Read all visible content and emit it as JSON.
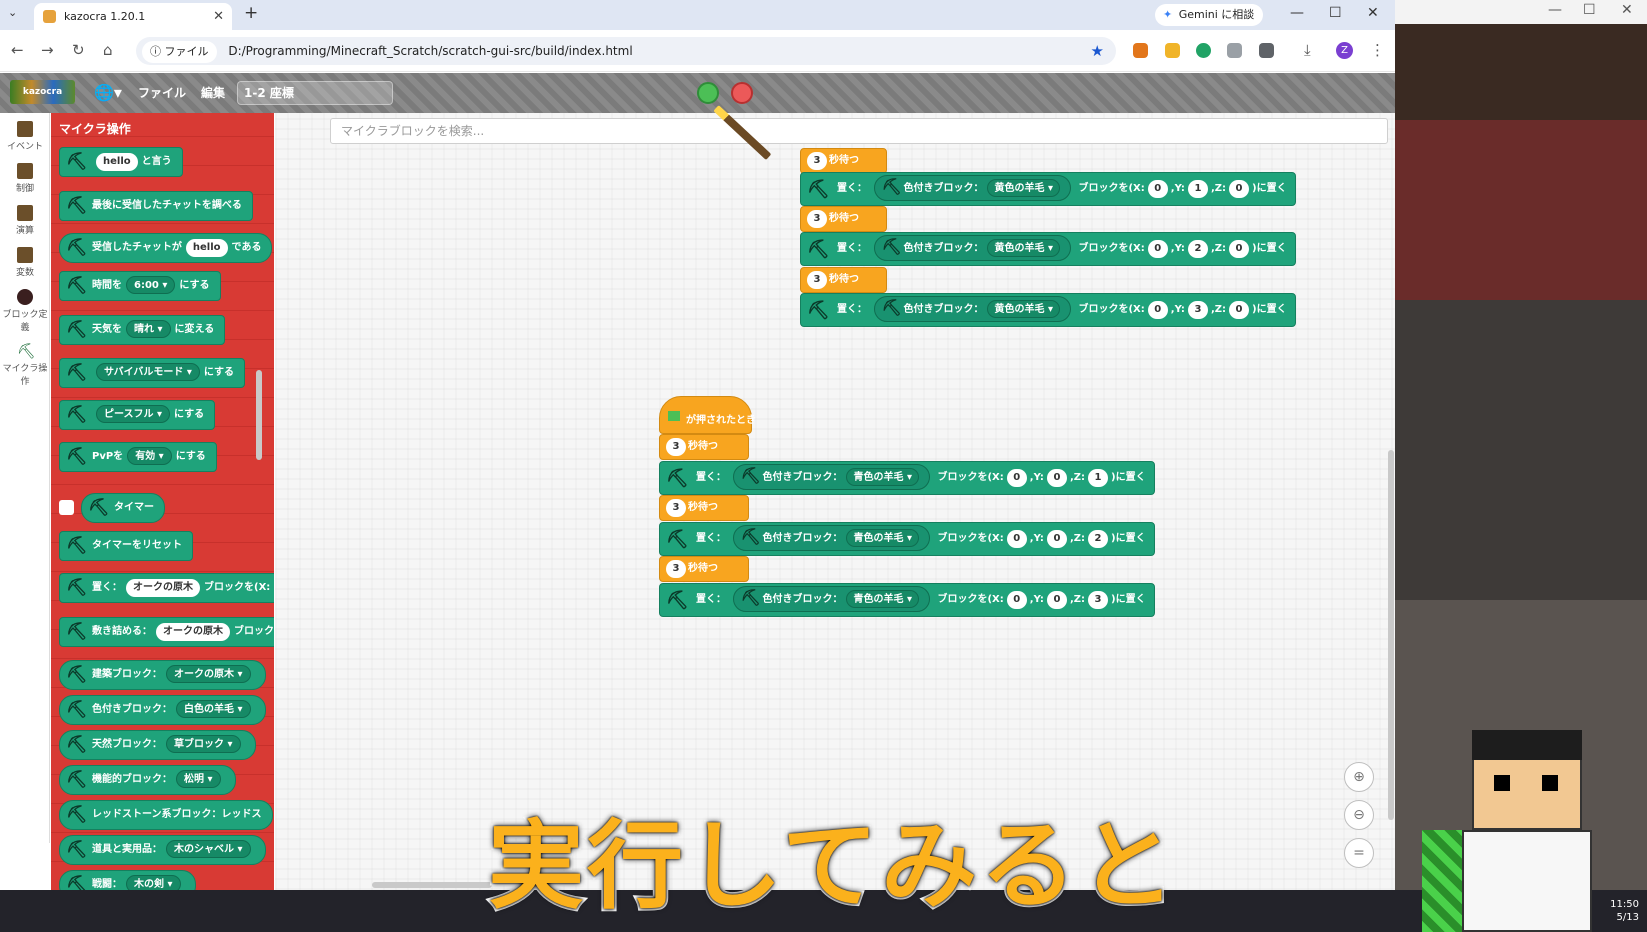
{
  "browser": {
    "tab_title": "kazocra 1.20.1",
    "gemini_label": "Gemini に相談",
    "security_label": "ファイル",
    "url": "D:/Programming/Minecraft_Scratch/scratch-gui-src/build/index.html",
    "profile_initial": "Z"
  },
  "menubar": {
    "file_label": "ファイル",
    "edit_label": "編集",
    "project_title": "1-2 座標"
  },
  "categories": [
    "イベント",
    "制御",
    "演算",
    "変数",
    "ブロック定義",
    "マイクラ操作"
  ],
  "flyout": {
    "title": "マイクラ操作",
    "blocks": {
      "say_value": "hello",
      "say_suffix": "と言う",
      "last_chat": "最後に受信したチャットを調べる",
      "chat_prefix": "受信したチャットが",
      "chat_value": "hello",
      "chat_suffix": "である",
      "time_prefix": "時間を",
      "time_value": "6:00",
      "time_suffix": "にする",
      "weather_prefix": "天気を",
      "weather_value": "晴れ",
      "weather_suffix": "に変える",
      "mode_value": "サバイバルモード",
      "mode_suffix": "にする",
      "peace_value": "ピースフル",
      "peace_suffix": "にする",
      "pvp_prefix": "PvPを",
      "pvp_value": "有効",
      "pvp_suffix": "にする",
      "timer": "タイマー",
      "timer_reset": "タイマーをリセット",
      "place_prefix": "置く：",
      "place_value": "オークの原木",
      "place_suffix": "ブロックを(X:",
      "fill_prefix": "敷き詰める：",
      "fill_value": "オークの原木",
      "fill_suffix": "ブロック",
      "build_prefix": "建築ブロック：",
      "build_value": "オークの原木",
      "color_prefix": "色付きブロック：",
      "color_value": "白色の羊毛",
      "nature_prefix": "天然ブロック：",
      "nature_value": "草ブロック",
      "func_prefix": "機能的ブロック：",
      "func_value": "松明",
      "redstone_prefix": "レッドストーン系ブロック：",
      "redstone_value": "レッドス",
      "tools_prefix": "道具と実用品：",
      "tools_value": "木のシャベル",
      "weapon_prefix": "戦闘：",
      "weapon_value": "木の剣"
    }
  },
  "workspace": {
    "search_placeholder": "マイクラブロックを検索...",
    "labels": {
      "wait_suffix": "秒待つ",
      "place": "置く：",
      "colored": "色付きブロック：",
      "block_x": "ブロックを(X:",
      "y": ",Y:",
      "z": ",Z:",
      "place_end": ")に置く",
      "hat": "が押されたとき"
    },
    "top_script": {
      "waits": [
        "3",
        "3",
        "3"
      ],
      "places": [
        {
          "wool": "黄色の羊毛",
          "x": "0",
          "y": "1",
          "z": "0"
        },
        {
          "wool": "黄色の羊毛",
          "x": "0",
          "y": "2",
          "z": "0"
        },
        {
          "wool": "黄色の羊毛",
          "x": "0",
          "y": "3",
          "z": "0"
        }
      ]
    },
    "bottom_script": {
      "waits": [
        "3",
        "3",
        "3"
      ],
      "places": [
        {
          "wool": "青色の羊毛",
          "x": "0",
          "y": "0",
          "z": "1"
        },
        {
          "wool": "青色の羊毛",
          "x": "0",
          "y": "0",
          "z": "2"
        },
        {
          "wool": "青色の羊毛",
          "x": "0",
          "y": "0",
          "z": "3"
        }
      ]
    }
  },
  "taskbar": {
    "time": "11:50",
    "date": "5/13"
  },
  "caption": "実行してみると",
  "colors": {
    "motion_green": "#1fa37b",
    "control_orange": "#f8a51f",
    "flyout_red": "#d83a34",
    "caption_orange": "#fbb11c"
  }
}
